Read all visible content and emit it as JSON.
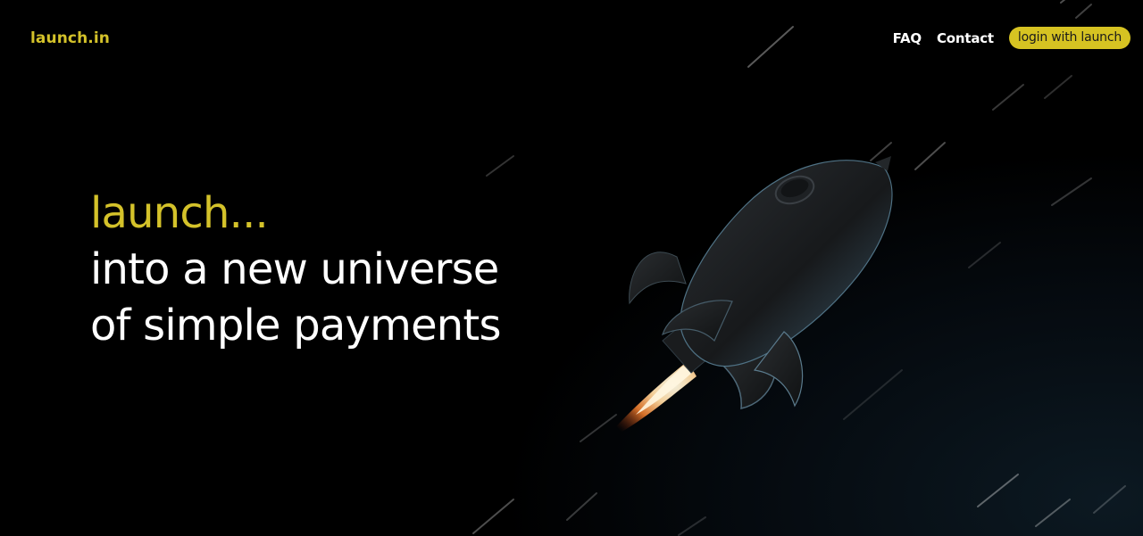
{
  "header": {
    "logo": "launch.in",
    "nav": [
      {
        "label": "FAQ"
      },
      {
        "label": "Contact"
      }
    ],
    "login_label": "login with launch"
  },
  "hero": {
    "title_accent": "launch...",
    "line1": "into a new universe",
    "line2": "of simple payments"
  },
  "colors": {
    "accent": "#d4c22a",
    "background": "#000000",
    "text": "#ffffff"
  },
  "icons": {
    "illustration": "rocket-icon"
  }
}
